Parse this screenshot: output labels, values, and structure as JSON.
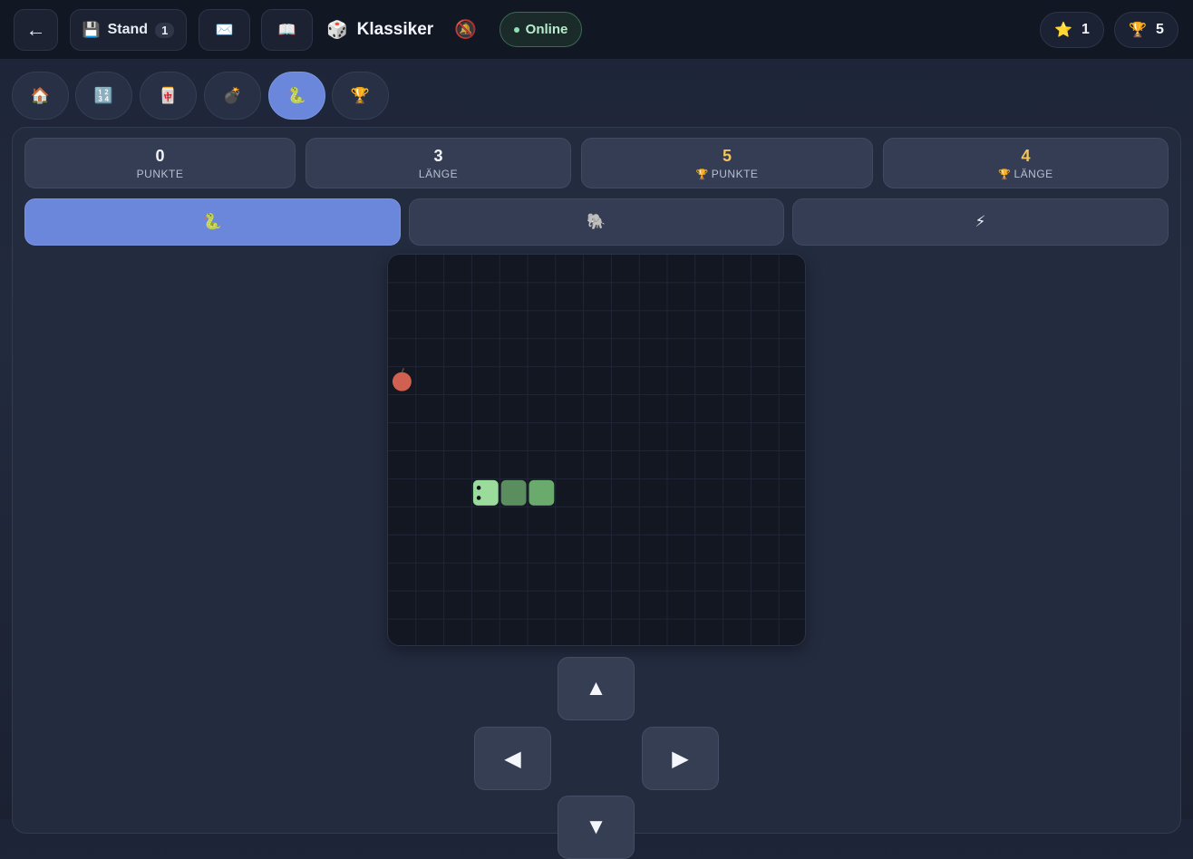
{
  "header": {
    "back_icon": "←",
    "save_icon": "💾",
    "save_label": "Stand",
    "save_count": "1",
    "mail_icon": "✉️",
    "book_icon": "📖",
    "game_icon": "🎲",
    "title": "Klassiker",
    "bell_icon": "🔕",
    "status": "Online",
    "stars_icon": "⭐",
    "stars": "1",
    "trophy_icon": "🏆",
    "trophies": "5"
  },
  "nav": [
    {
      "icon": "🏠",
      "name": "home"
    },
    {
      "icon": "🔢",
      "name": "numbers"
    },
    {
      "icon": "🀄",
      "name": "cards"
    },
    {
      "icon": "💣",
      "name": "bombs"
    },
    {
      "icon": "🐍",
      "name": "snake",
      "active": true
    },
    {
      "icon": "🏆",
      "name": "trophies"
    }
  ],
  "stats": [
    {
      "value": "0",
      "label": "PUNKTE",
      "trophy": false
    },
    {
      "value": "3",
      "label": "LÄNGE",
      "trophy": false
    },
    {
      "value": "5",
      "label": "PUNKTE",
      "trophy": true
    },
    {
      "value": "4",
      "label": "LÄNGE",
      "trophy": true
    }
  ],
  "stat_trophy_icon": "🏆",
  "modes": [
    {
      "icon": "🐍",
      "name": "classic",
      "active": true
    },
    {
      "icon": "🐘",
      "name": "slow"
    },
    {
      "icon": "⚡",
      "name": "fast"
    }
  ],
  "game": {
    "grid_cols": 15,
    "grid_rows": 14,
    "food_icon": "apple-icon",
    "food_cell": [
      0,
      4
    ],
    "snake_cells": [
      [
        3,
        8
      ],
      [
        4,
        8
      ],
      [
        5,
        8
      ]
    ],
    "snake_head_color": "#9bdc9d",
    "snake_body_color": "#5a8e5e",
    "snake_tail_color": "#6aaa6c",
    "food_color": "#d0604f",
    "grid_color": "#202636"
  },
  "controls": {
    "up": "▲",
    "left": "◀",
    "right": "▶",
    "down": "▼"
  },
  "colors": {
    "accent": "#6b87dc",
    "online": "#8de2b0",
    "gold": "#f2c45a"
  }
}
